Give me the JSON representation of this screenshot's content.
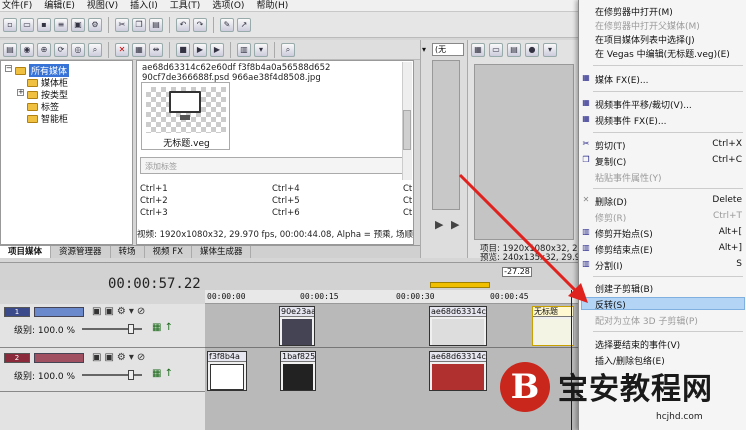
{
  "menu": [
    "文件(F)",
    "编辑(E)",
    "视图(V)",
    "插入(I)",
    "工具(T)",
    "选项(O)",
    "帮助(H)"
  ],
  "tree": {
    "items": [
      "所有媒体",
      "媒体柜",
      "按类型",
      "标签",
      "智能柜"
    ]
  },
  "media": {
    "line1": "ae68d63314c62e60df   f3f8b4a0a56588d652",
    "line2": "90cf7de366688f.psd   966ae38f4d8508.jpg",
    "thumb_label": "无标题.veg",
    "tag_placeholder": "添加标签",
    "shortcuts": [
      [
        "Ctrl+1",
        "Ctrl+4",
        "Ct"
      ],
      [
        "Ctrl+2",
        "Ctrl+5",
        "Ct"
      ],
      [
        "Ctrl+3",
        "Ctrl+6",
        "Ct"
      ]
    ],
    "info": "视频: 1920x1080x32, 29.970 fps, 00:00:44.08, Alpha = 预乘, 场顺序"
  },
  "tabs": [
    "项目媒体",
    "资源管理器",
    "转场",
    "视频 FX",
    "媒体生成器"
  ],
  "mid": {
    "dropdown": "(无"
  },
  "project": {
    "line1": "项目: 1920x1080x32, 29",
    "line2": "预览: 240x135x32, 29.9"
  },
  "timeline": {
    "current_time": "00:00:57.22",
    "marker": "-27.28",
    "ruler": [
      "00:00:00",
      "00:00:15",
      "00:00:30",
      "00:00:45"
    ],
    "track1": {
      "num": "1",
      "level_label": "级别: 100.0 %"
    },
    "track2": {
      "num": "2",
      "level_label": "级别: 100.0 %"
    },
    "clips": [
      "90e23aa",
      "ae68d63314c",
      "无标题",
      "f3f8b4a",
      "1baf825",
      "ae68d63314c"
    ]
  },
  "context_menu": {
    "items": [
      {
        "label": "在修剪器中打开(M)",
        "shortcut": ""
      },
      {
        "label": "在修剪器中打开父媒体(M)",
        "shortcut": ""
      },
      {
        "label": "在项目媒体列表中选择(J)",
        "shortcut": ""
      },
      {
        "label": "在 Vegas 中编辑(无标题.veg)(E)",
        "shortcut": ""
      },
      {
        "label": "媒体 FX(E)...",
        "shortcut": ""
      },
      {
        "label": "视频事件平移/裁切(V)...",
        "shortcut": ""
      },
      {
        "label": "视频事件 FX(E)...",
        "shortcut": ""
      },
      {
        "label": "剪切(T)",
        "shortcut": "Ctrl+X"
      },
      {
        "label": "复制(C)",
        "shortcut": "Ctrl+C"
      },
      {
        "label": "粘贴事件属性(Y)",
        "shortcut": ""
      },
      {
        "label": "删除(D)",
        "shortcut": "Delete"
      },
      {
        "label": "修剪(R)",
        "shortcut": "Ctrl+T"
      },
      {
        "label": "修剪开始点(S)",
        "shortcut": "Alt+["
      },
      {
        "label": "修剪结束点(E)",
        "shortcut": "Alt+]"
      },
      {
        "label": "分割(I)",
        "shortcut": "S"
      },
      {
        "label": "创建子剪辑(B)",
        "shortcut": ""
      },
      {
        "label": "反转(S)",
        "shortcut": ""
      },
      {
        "label": "配对为立体 3D 子剪辑(P)",
        "shortcut": ""
      },
      {
        "label": "选择要结束的事件(V)",
        "shortcut": ""
      },
      {
        "label": "插入/删除包络(E)",
        "shortcut": ""
      }
    ]
  },
  "watermark": {
    "logo_char": "B",
    "text": "宝安教程网",
    "url": "hcjhd.com"
  },
  "colors": {
    "selection": "#3874d8",
    "highlight": "#b3d4f5",
    "arrow": "#e0221e",
    "logo": "#c9261c"
  }
}
